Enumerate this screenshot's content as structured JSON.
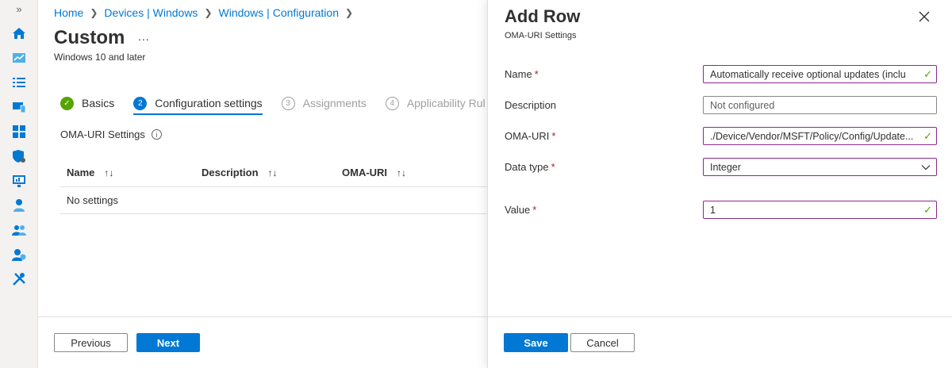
{
  "rail": {
    "expand_glyph": "»",
    "icons": [
      "home-icon",
      "dashboard-icon",
      "all-services-icon",
      "devices-icon",
      "apps-icon",
      "endpoint-security-icon",
      "reports-icon",
      "users-icon",
      "groups-icon",
      "tenant-admin-icon",
      "troubleshooting-icon"
    ]
  },
  "breadcrumb": [
    "Home",
    "Devices | Windows",
    "Windows | Configuration"
  ],
  "page": {
    "title": "Custom",
    "more": "...",
    "subtitle": "Windows 10 and later"
  },
  "steps": [
    {
      "num": "✓",
      "label": "Basics",
      "state": "done"
    },
    {
      "num": "2",
      "label": "Configuration settings",
      "state": "active"
    },
    {
      "num": "3",
      "label": "Assignments",
      "state": "idle"
    },
    {
      "num": "4",
      "label": "Applicability Rul",
      "state": "idle"
    }
  ],
  "oma_section": {
    "label": "OMA-URI Settings",
    "info": "i"
  },
  "table": {
    "columns": [
      "Name",
      "Description",
      "OMA-URI"
    ],
    "sort_glyph": "↑↓",
    "empty_text": "No settings"
  },
  "footer": {
    "previous": "Previous",
    "next": "Next"
  },
  "panel": {
    "title": "Add Row",
    "subtitle": "OMA-URI Settings",
    "required_mark": "*",
    "fields": {
      "name": {
        "label": "Name",
        "value": "Automatically receive optional updates (inclu"
      },
      "description": {
        "label": "Description",
        "placeholder": "Not configured"
      },
      "oma_uri": {
        "label": "OMA-URI",
        "value": "./Device/Vendor/MSFT/Policy/Config/Update..."
      },
      "data_type": {
        "label": "Data type",
        "value": "Integer"
      },
      "value": {
        "label": "Value",
        "value": "1"
      }
    },
    "check_glyph": "✓",
    "save": "Save",
    "cancel": "Cancel"
  },
  "colors": {
    "accent": "#0078d4",
    "success": "#57a300",
    "required": "#a4262c",
    "valid_border": "#8a2a8a"
  }
}
